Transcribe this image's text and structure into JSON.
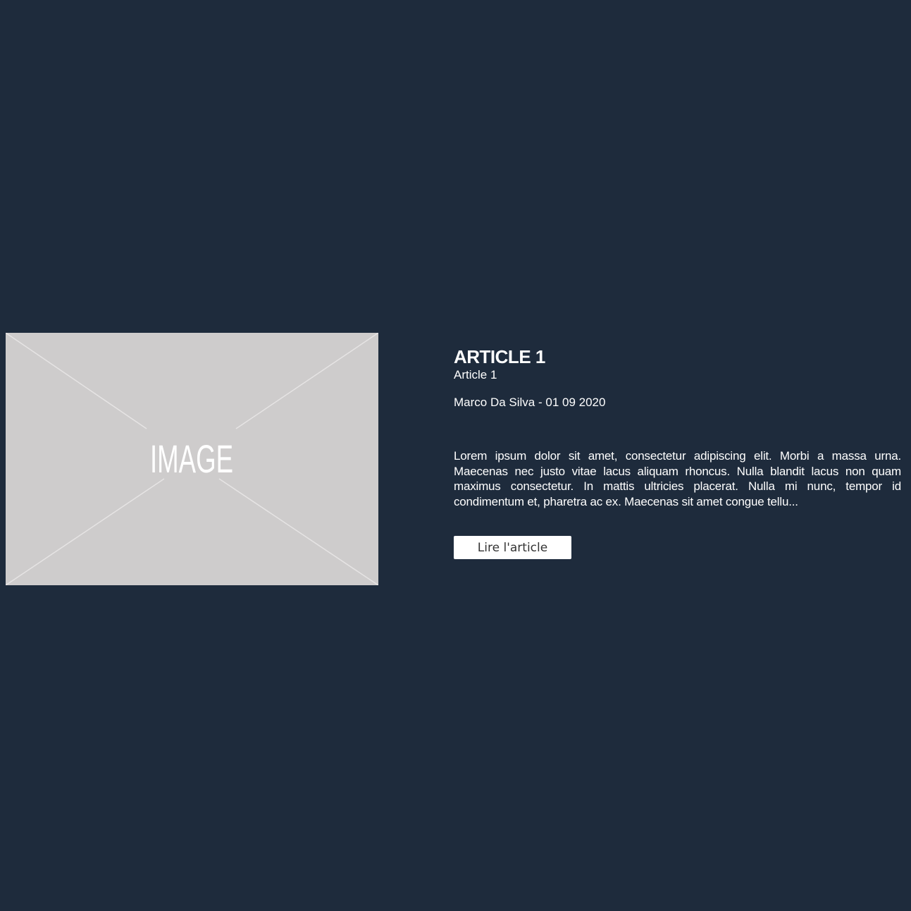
{
  "colors": {
    "background": "#1e2b3c",
    "placeholder": "#cecccc"
  },
  "image_placeholder": {
    "label": "IMAGE"
  },
  "article": {
    "title": "ARTICLE 1",
    "subtitle": "Article 1",
    "meta": "Marco Da Silva - 01 09 2020",
    "excerpt": "Lorem ipsum dolor sit amet, consectetur adipiscing elit. Morbi a massa urna. Maecenas nec justo vitae lacus aliquam rhoncus. Nulla blandit lacus non quam maximus consectetur. In mattis ultricies placerat. Nulla mi nunc, tempor id condimentum et, pharetra ac ex. Maecenas sit amet congue tellu...",
    "read_button": "Lire l'article"
  }
}
